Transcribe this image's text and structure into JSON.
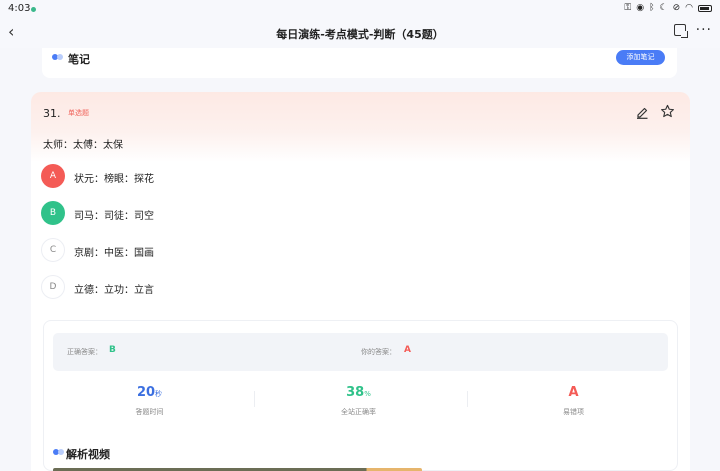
{
  "status_bar": {
    "time": "4:03",
    "icons": [
      "key-icon",
      "eye-icon",
      "bluetooth-icon",
      "moon-icon",
      "mute-icon",
      "wifi-icon",
      "battery-icon"
    ]
  },
  "nav": {
    "title": "每日演练-考点模式-判断（45题）",
    "back_icon": "chevron-left-icon",
    "right_icons": [
      "feedback-icon",
      "more-icon"
    ]
  },
  "note": {
    "label": "笔记",
    "add_button": "添加笔记"
  },
  "question": {
    "number": "31.",
    "type": "单选题",
    "stem": "太师：太傅：太保",
    "options": [
      {
        "letter": "A",
        "text": "状元：榜眼：探花",
        "state": "wrong"
      },
      {
        "letter": "B",
        "text": "司马：司徒：司空",
        "state": "right"
      },
      {
        "letter": "C",
        "text": "京剧：中医：国画",
        "state": "plain"
      },
      {
        "letter": "D",
        "text": "立德：立功：立言",
        "state": "plain"
      }
    ]
  },
  "answer": {
    "correct_label": "正确答案：",
    "correct_value": "B",
    "yours_label": "你的答案：",
    "yours_value": "A",
    "stats": [
      {
        "value": "20",
        "unit": "秒",
        "label": "答题时间",
        "color": "#3b6fe0"
      },
      {
        "value": "38",
        "unit": "%",
        "label": "全站正确率",
        "color": "#30c28a"
      },
      {
        "value": "A",
        "unit": "",
        "label": "易错项",
        "color": "#f45b56"
      }
    ],
    "video_label": "解析视频"
  },
  "colors": {
    "accent": "#4a7cf6",
    "correct": "#30c28a",
    "wrong": "#f45b56"
  }
}
